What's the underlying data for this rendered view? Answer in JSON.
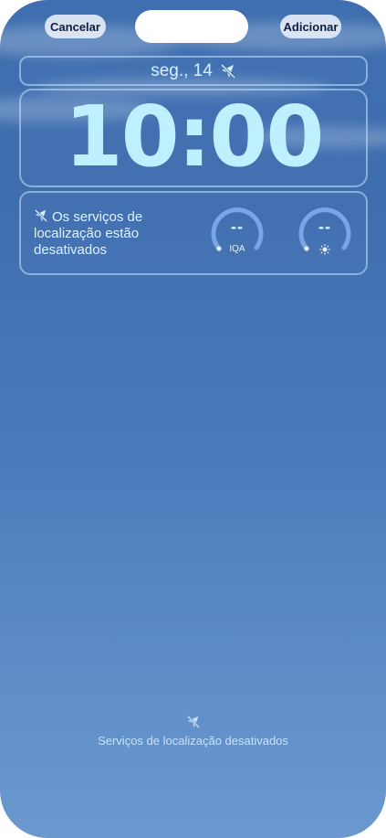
{
  "header": {
    "cancel_label": "Cancelar",
    "add_label": "Adicionar"
  },
  "lockscreen": {
    "date": "seg., 14",
    "time": "10:00"
  },
  "widgets": {
    "location_message": "Os serviços de localização estão desativados",
    "aqi": {
      "value": "--",
      "label": "IQA"
    },
    "uv": {
      "value": "--",
      "icon": "sun-icon"
    }
  },
  "footer": {
    "message": "Serviços de localização desativados",
    "icon": "location-off-icon"
  },
  "colors": {
    "wallpaper_top": "#3f6fb0",
    "wallpaper_bottom": "#6a98cf",
    "clock": "#bff0ff",
    "button_bg": "#ebf0fa"
  }
}
